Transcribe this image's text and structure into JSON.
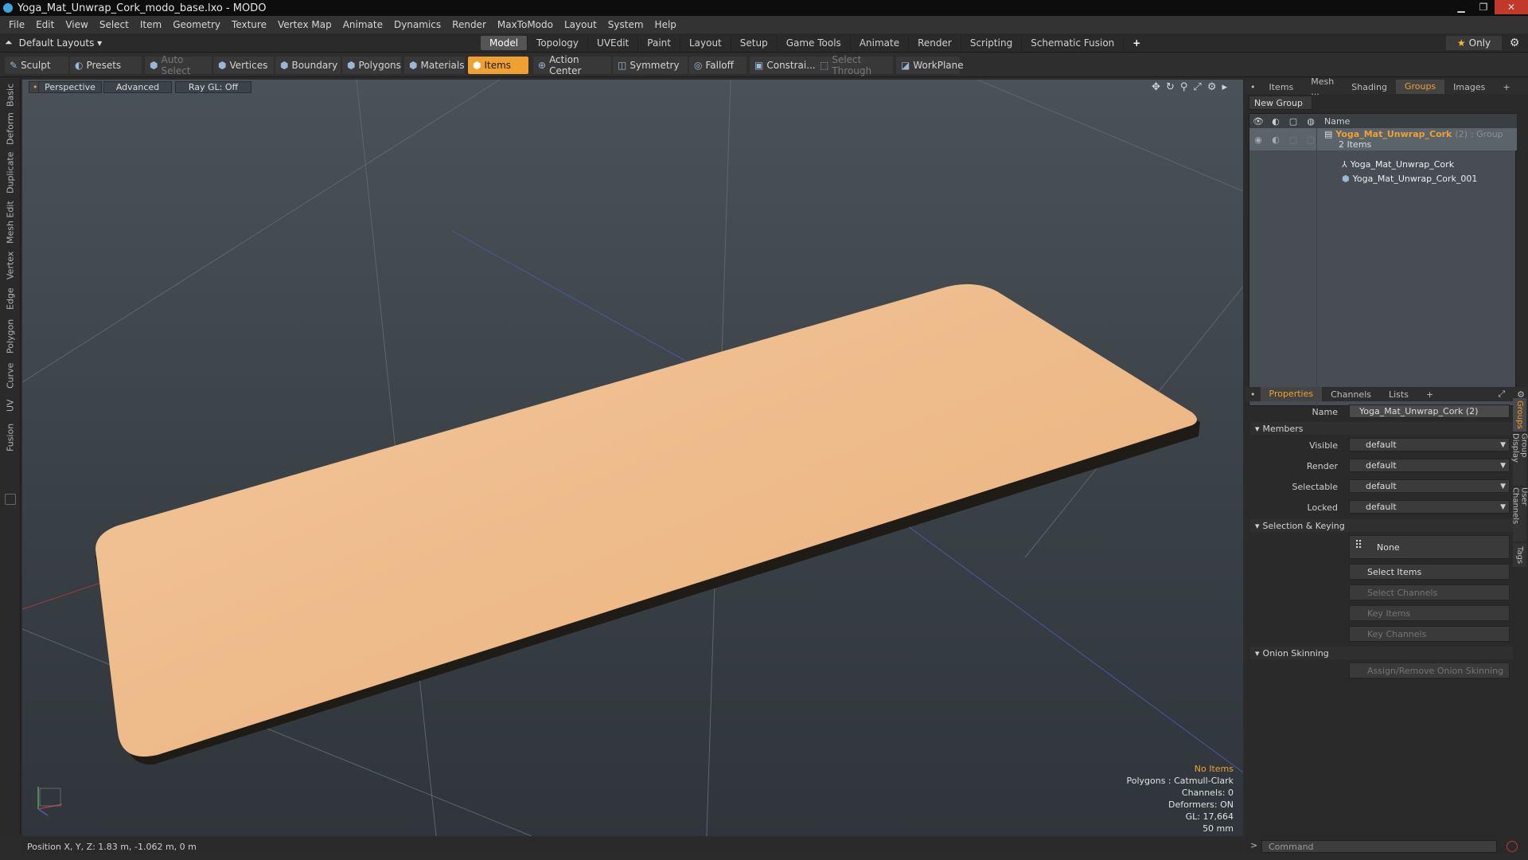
{
  "window": {
    "title": "Yoga_Mat_Unwrap_Cork_modo_base.lxo - MODO",
    "minimize": "▁",
    "maximize": "❐",
    "close": "✕"
  },
  "menu": [
    "File",
    "Edit",
    "View",
    "Select",
    "Item",
    "Geometry",
    "Texture",
    "Vertex Map",
    "Animate",
    "Dynamics",
    "Render",
    "MaxToModo",
    "Layout",
    "System",
    "Help"
  ],
  "layoutbar": {
    "layouts": "Default Layouts ▾",
    "tabs": [
      "Model",
      "Topology",
      "UVEdit",
      "Paint",
      "Layout",
      "Setup",
      "Game Tools",
      "Animate",
      "Render",
      "Scripting",
      "Schematic Fusion"
    ],
    "active_tab": "Model",
    "add": "+",
    "only": "Only"
  },
  "toolbar": {
    "sculpt": "Sculpt",
    "presets": "Presets",
    "auto_select": "Auto Select",
    "vertices": "Vertices",
    "boundary": "Boundary",
    "polygons": "Polygons",
    "materials": "Materials",
    "items": "Items",
    "action_center": "Action Center",
    "symmetry": "Symmetry",
    "falloff": "Falloff",
    "constraints": "Constrai...",
    "select_through": "Select Through",
    "workplane": "WorkPlane"
  },
  "sidetabs": [
    "Basic",
    "Deform",
    "Duplicate",
    "Mesh Edit",
    "Vertex",
    "Edge",
    "Polygon",
    "Curve",
    "UV",
    "Fusion"
  ],
  "viewport": {
    "view": "Perspective",
    "shading": "Advanced",
    "raygl": "Ray GL: Off",
    "info": {
      "items": "No Items",
      "polygons": "Polygons : Catmull-Clark",
      "channels": "Channels: 0",
      "deformers": "Deformers: ON",
      "gl": "GL: 17,664",
      "focal": "50 mm"
    }
  },
  "status": {
    "position": "Position X, Y, Z:  1.83 m, -1.062 m, 0 m"
  },
  "top_panel": {
    "tabs": [
      "Items",
      "Mesh ...",
      "Shading",
      "Groups",
      "Images"
    ],
    "active_tab": "Groups",
    "new_group": "New Group",
    "column_name": "Name",
    "group": {
      "name": "Yoga_Mat_Unwrap_Cork",
      "count": "(2)",
      "type": ": Group",
      "items_label": "2 Items"
    },
    "children": [
      "Yoga_Mat_Unwrap_Cork",
      "Yoga_Mat_Unwrap_Cork_001"
    ]
  },
  "properties": {
    "tabs": [
      "Properties",
      "Channels",
      "Lists"
    ],
    "active_tab": "Properties",
    "name_label": "Name",
    "name_value": "Yoga_Mat_Unwrap_Cork (2)",
    "members_section": "Members",
    "fields": [
      {
        "label": "Visible",
        "value": "default"
      },
      {
        "label": "Render",
        "value": "default"
      },
      {
        "label": "Selectable",
        "value": "default"
      },
      {
        "label": "Locked",
        "value": "default"
      }
    ],
    "selection_section": "Selection & Keying",
    "none_label": "None",
    "select_items": "Select Items",
    "select_channels": "Select Channels",
    "key_items": "Key Items",
    "key_channels": "Key Channels",
    "onion_section": "Onion Skinning",
    "onion_button": "Assign/Remove Onion Skinning",
    "side_tabs": [
      "Groups",
      "Group Display",
      "User Channels",
      "Tags"
    ]
  },
  "command": {
    "placeholder": "Command"
  }
}
